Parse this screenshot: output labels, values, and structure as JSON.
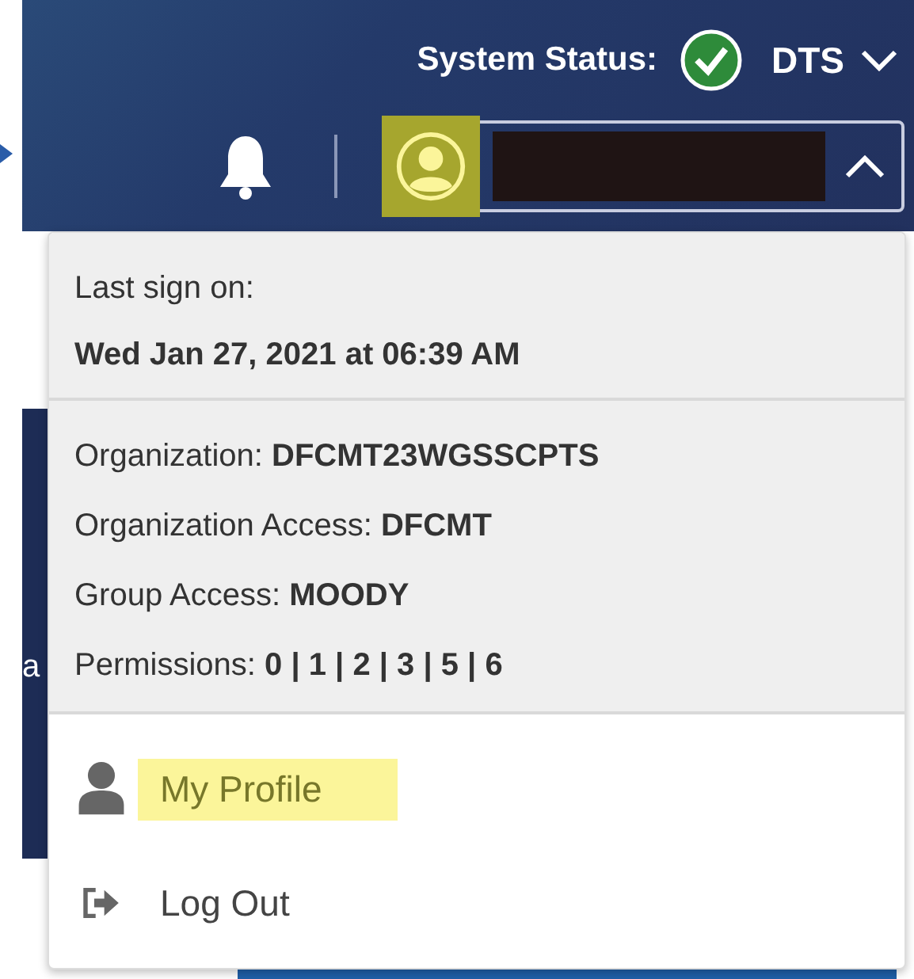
{
  "header": {
    "status_label": "System Status:",
    "status_ok": true,
    "system": "DTS",
    "user_menu": {
      "expanded": true,
      "avatar_highlighted": true
    }
  },
  "menu": {
    "last_sign_on_label": "Last sign on:",
    "last_sign_on": "Wed Jan 27, 2021 at 06:39 AM",
    "details": [
      "Organization: **DFCMT23WGSSCPTS**",
      "Organization Access: **DFCMT**",
      "Group Access: **MOODY**",
      "Permissions: **0 | 1 | 2 | 3 | 5 | 6**"
    ],
    "items": [
      {
        "kind": "profile",
        "label": "My Profile",
        "highlighted": true
      },
      {
        "kind": "logout",
        "label": "Log Out",
        "highlighted": false
      }
    ]
  },
  "background_text": "a"
}
